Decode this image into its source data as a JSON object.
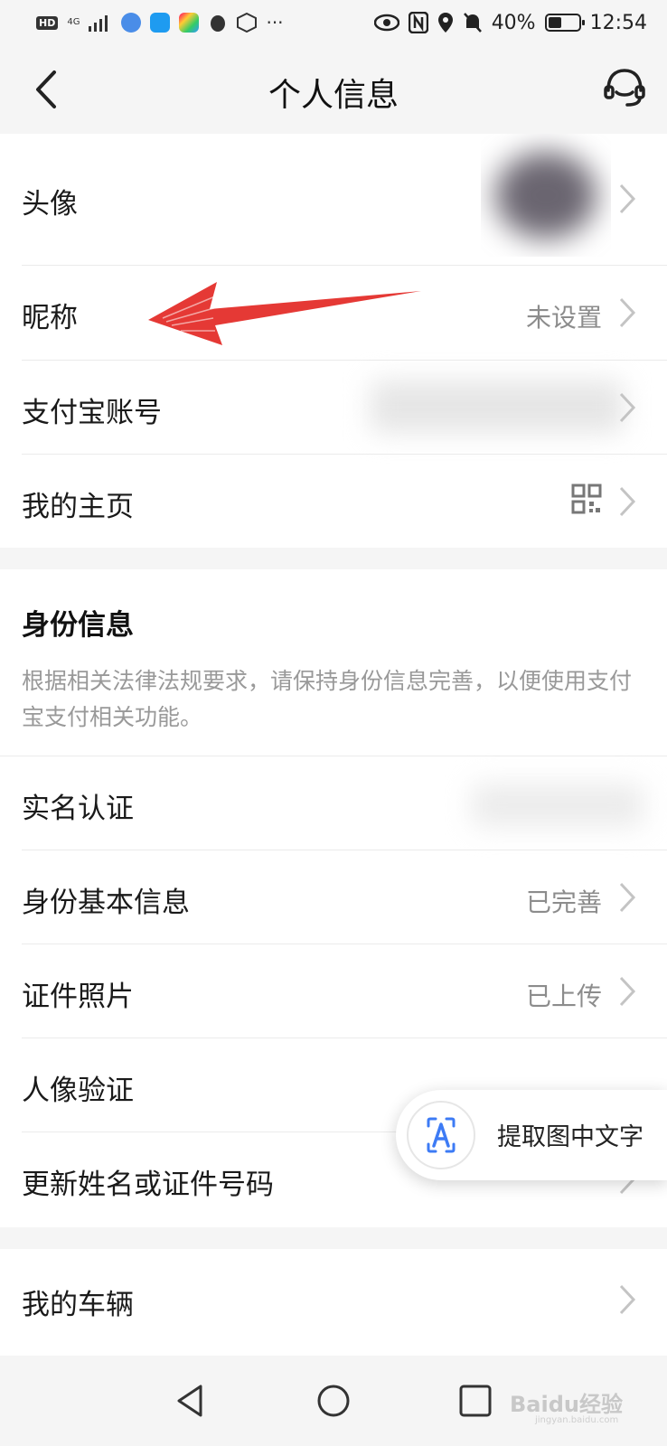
{
  "status_bar": {
    "network": "4G",
    "battery": "40%",
    "time": "12:54",
    "more": "···"
  },
  "header": {
    "title": "个人信息"
  },
  "profile": {
    "avatar_label": "头像",
    "nickname_label": "昵称",
    "nickname_value": "未设置",
    "account_label": "支付宝账号",
    "homepage_label": "我的主页"
  },
  "identity": {
    "title": "身份信息",
    "description": "根据相关法律法规要求，请保持身份信息完善，以便使用支付宝支付相关功能。",
    "items": [
      {
        "label": "实名认证",
        "value": ""
      },
      {
        "label": "身份基本信息",
        "value": "已完善"
      },
      {
        "label": "证件照片",
        "value": "已上传"
      },
      {
        "label": "人像验证",
        "value": ""
      },
      {
        "label": "更新姓名或证件号码",
        "value": ""
      }
    ]
  },
  "vehicle": {
    "label": "我的车辆"
  },
  "float_tool": {
    "label": "提取图中文字"
  },
  "watermark": {
    "text": "Baidu经验",
    "url": "jingyan.baidu.com"
  },
  "colors": {
    "annotation_arrow": "#e53935",
    "text_primary": "#1a1a1a",
    "text_secondary": "#8c8c8c",
    "ocr_icon": "#3d7bf5"
  }
}
